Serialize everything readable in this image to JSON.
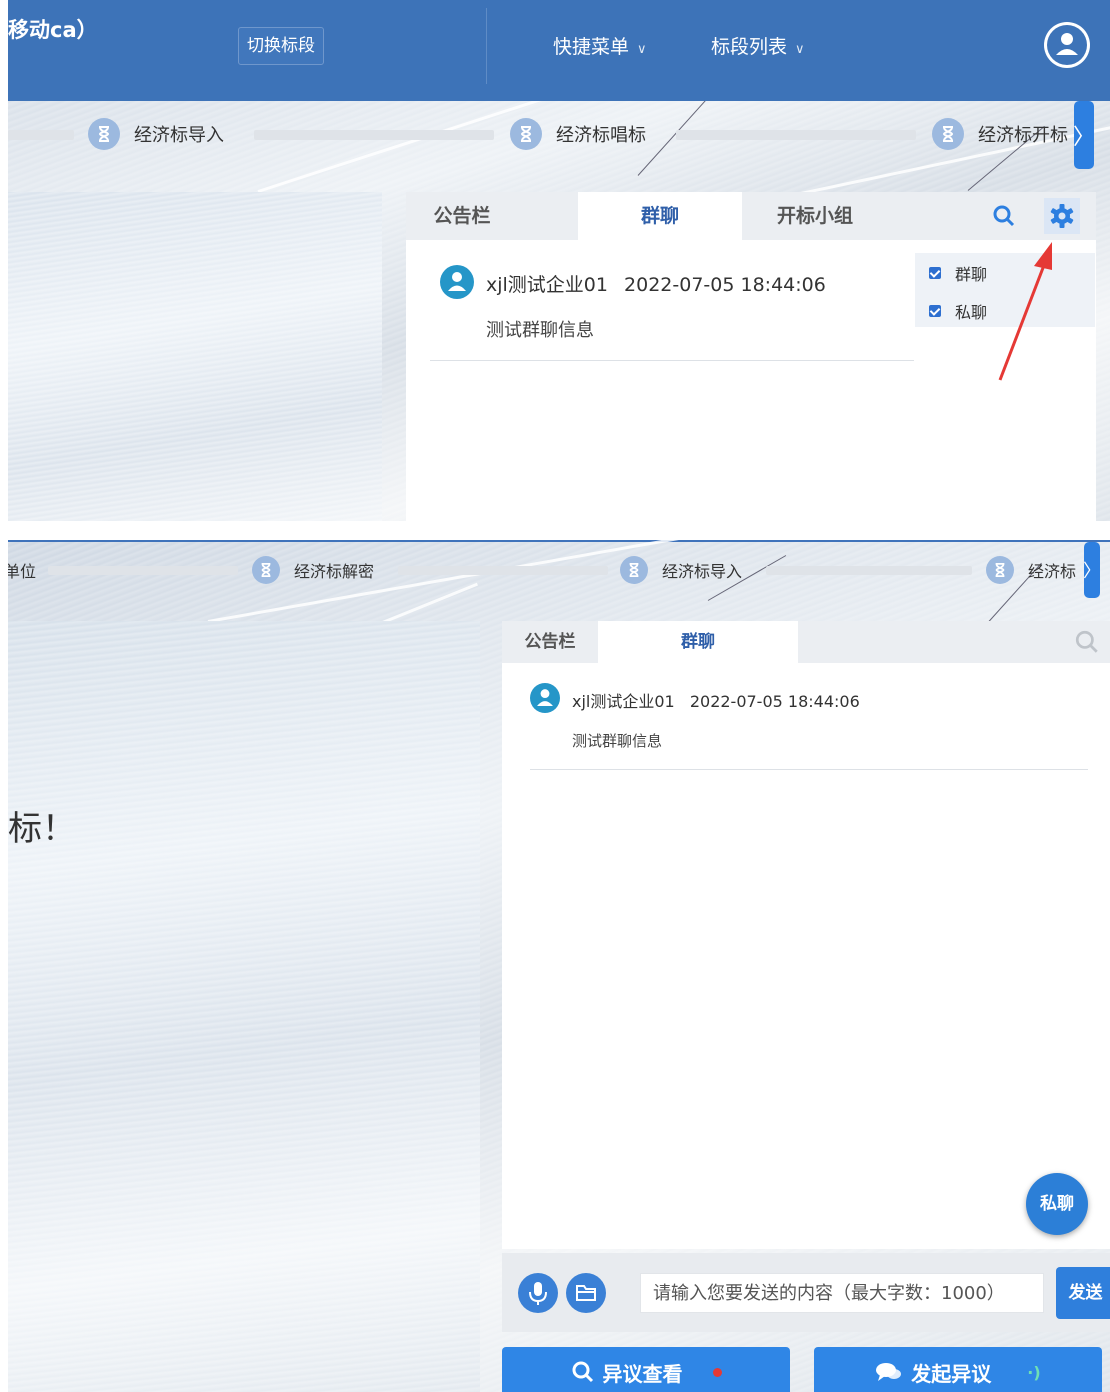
{
  "top": {
    "header": {
      "title_fragment": "移动ca）",
      "switch_button": "切换标段",
      "menu_quick": "快捷菜单",
      "menu_sections": "标段列表"
    },
    "steps": [
      "经济标导入",
      "经济标唱标",
      "经济标开标"
    ],
    "tabs": [
      "公告栏",
      "群聊",
      "开标小组"
    ],
    "active_tab": "群聊",
    "message": {
      "sender": "xjl测试企业01",
      "time": "2022-07-05 18:44:06",
      "text": "测试群聊信息"
    },
    "settings_menu": {
      "items": [
        {
          "label": "群聊",
          "checked": true
        },
        {
          "label": "私聊",
          "checked": true
        }
      ]
    },
    "colors": {
      "header": "#3d73b8",
      "accent": "#2f5fa9",
      "annotation_arrow": "#e53935"
    }
  },
  "bottom": {
    "steps": [
      "单位",
      "经济标解密",
      "经济标导入",
      "经济标"
    ],
    "left_text": "标！",
    "tabs": [
      "公告栏",
      "群聊"
    ],
    "active_tab": "群聊",
    "message": {
      "sender": "xjl测试企业01",
      "time": "2022-07-05 18:44:06",
      "text": "测试群聊信息"
    },
    "private_chat_button": "私聊",
    "input_placeholder": "请输入您要发送的内容（最大字数：1000）",
    "send_button": "发送",
    "objection_view_button": "异议查看",
    "raise_objection_button": "发起异议"
  }
}
